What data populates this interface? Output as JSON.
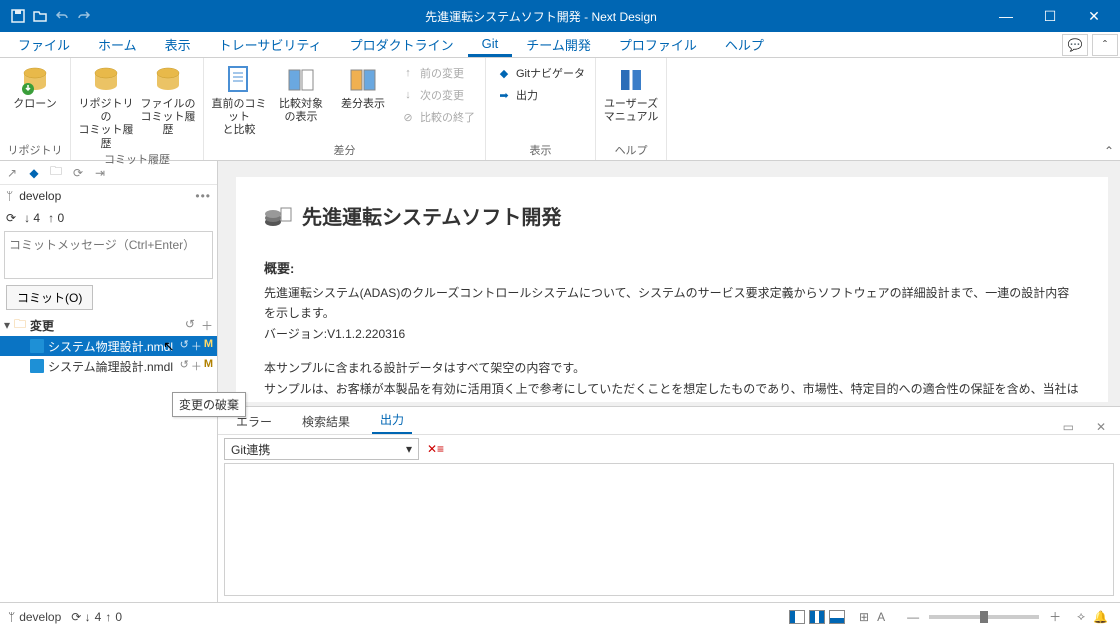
{
  "title": "先進運転システムソフト開発 - Next Design",
  "menu": [
    "ファイル",
    "ホーム",
    "表示",
    "トレーサビリティ",
    "プロダクトライン",
    "Git",
    "チーム開発",
    "プロファイル",
    "ヘルプ"
  ],
  "menu_active": 5,
  "ribbon": {
    "groups": [
      {
        "label": "リポジトリ",
        "items": [
          {
            "key": "clone",
            "label": "クローン"
          }
        ]
      },
      {
        "label": "コミット履歴",
        "items": [
          {
            "key": "repo-history",
            "label": "リポジトリの\nコミット履歴"
          },
          {
            "key": "file-history",
            "label": "ファイルの\nコミット履歴"
          }
        ]
      },
      {
        "label": "差分",
        "items": [
          {
            "key": "compare-prev",
            "label": "直前のコミット\nと比較"
          },
          {
            "key": "show-target",
            "label": "比較対象\nの表示"
          },
          {
            "key": "show-diff",
            "label": "差分表示"
          }
        ],
        "smalls": [
          {
            "key": "prev-change",
            "label": "前の変更",
            "disabled": true
          },
          {
            "key": "next-change",
            "label": "次の変更",
            "disabled": true
          },
          {
            "key": "end-compare",
            "label": "比較の終了",
            "disabled": true
          }
        ]
      },
      {
        "label": "表示",
        "smalls": [
          {
            "key": "git-nav",
            "label": "Gitナビゲータ"
          },
          {
            "key": "output",
            "label": "出力"
          }
        ]
      },
      {
        "label": "ヘルプ",
        "items": [
          {
            "key": "manual",
            "label": "ユーザーズ\nマニュアル"
          }
        ]
      }
    ]
  },
  "sidebar": {
    "branch": "develop",
    "sync": {
      "down": "4",
      "up": "0"
    },
    "commit_placeholder": "コミットメッセージ（Ctrl+Enter）",
    "commit_btn": "コミット(O)",
    "changes_label": "変更",
    "files": [
      {
        "name": "システム物理設計.nmdl",
        "status": "M",
        "selected": true
      },
      {
        "name": "システム論理設計.nmdl",
        "status": "M",
        "selected": false
      }
    ]
  },
  "tooltip": "変更の破棄",
  "doc": {
    "title": "先進運転システムソフト開発",
    "sec": "概要:",
    "p1": "先進運転システム(ADAS)のクルーズコントロールシステムについて、システムのサービス要求定義からソフトウェアの詳細設計まで、一連の設計内容を示します。",
    "p2": "バージョン:V1.1.2.220316",
    "p3": "本サンプルに含まれる設計データはすべて架空の内容です。",
    "p4": "サンプルは、お客様が本製品を有効に活用頂く上で参考にしていただくことを想定したものであり、市場性、特定目的への適合性の保証を含め、当社は一切の保証は行いません。"
  },
  "bottom": {
    "tabs": [
      "エラー",
      "検索結果",
      "出力"
    ],
    "active": 2,
    "filter": "Git連携"
  },
  "status": {
    "branch": "develop",
    "down": "4",
    "up": "0"
  }
}
